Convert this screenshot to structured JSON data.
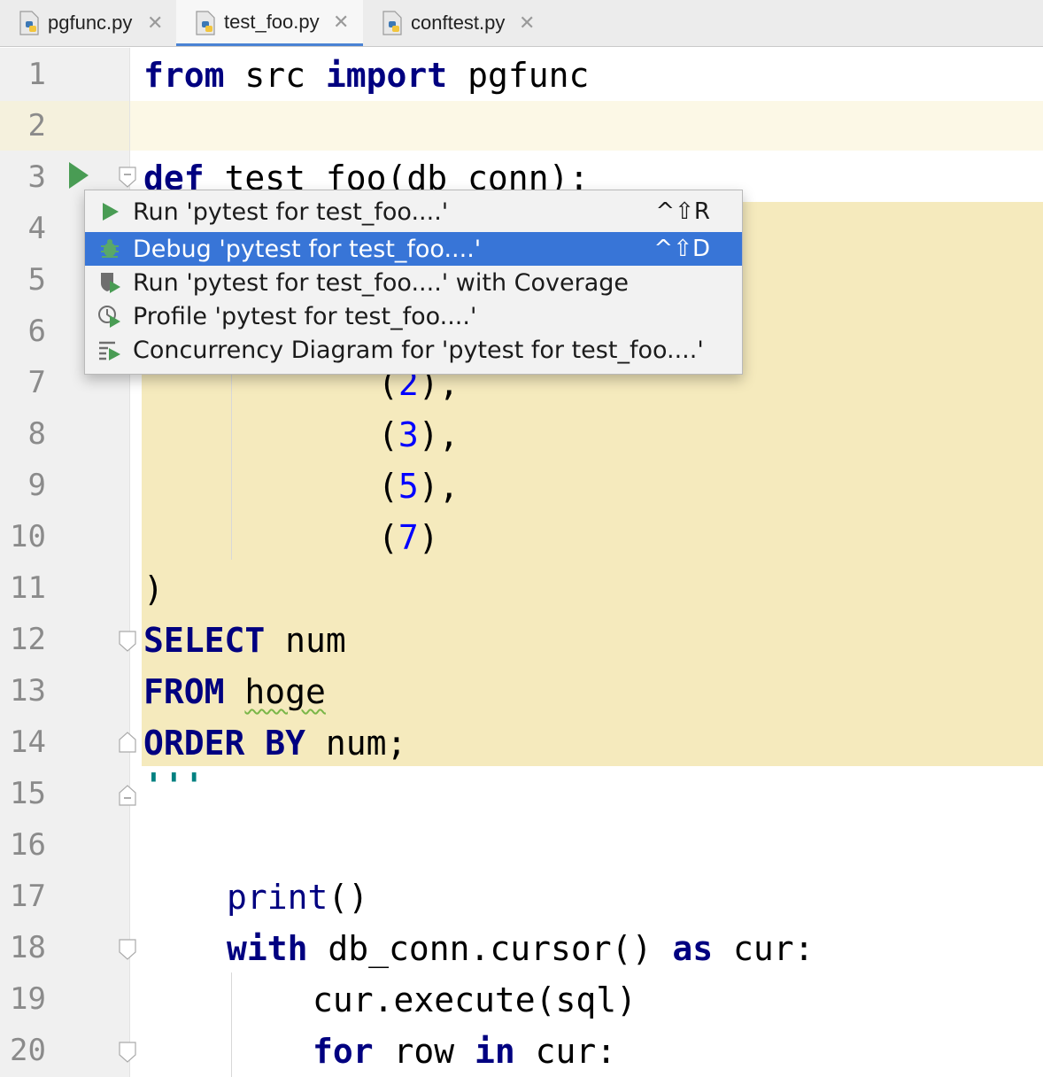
{
  "tabs": [
    {
      "label": "pgfunc.py",
      "close": "✕",
      "active": false,
      "icon": "python-file-icon"
    },
    {
      "label": "test_foo.py",
      "close": "✕",
      "active": true,
      "icon": "python-file-icon"
    },
    {
      "label": "conftest.py",
      "close": "✕",
      "active": false,
      "icon": "python-file-icon"
    }
  ],
  "line_numbers": [
    "1",
    "2",
    "3",
    "4",
    "5",
    "6",
    "7",
    "8",
    "9",
    "10",
    "11",
    "12",
    "13",
    "14",
    "15",
    "16",
    "17",
    "18",
    "19",
    "20"
  ],
  "code": {
    "l1": {
      "kw1": "from",
      "t1": " src ",
      "kw2": "import",
      "t2": " pgfunc"
    },
    "l3": {
      "kw": "def",
      "t": " test_foo(db_conn):"
    },
    "l7": {
      "open": "(",
      "n": "2",
      "close": "),"
    },
    "l8": {
      "open": "(",
      "n": "3",
      "close": "),"
    },
    "l9": {
      "open": "(",
      "n": "5",
      "close": "),"
    },
    "l10": {
      "open": "(",
      "n": "7",
      "close": ")"
    },
    "l11": ")",
    "l12": {
      "kw": "SELECT",
      "t": " num"
    },
    "l13": {
      "kw": "FROM",
      "t": " ",
      "ident": "hoge"
    },
    "l14": {
      "kw1": "ORDER",
      "t1": " ",
      "kw2": "BY",
      "t2": " num;"
    },
    "l15": "'''",
    "l17": {
      "fn": "print",
      "t": "()"
    },
    "l18": {
      "kw1": "with",
      "t1": " db_conn.cursor() ",
      "kw2": "as",
      "t2": " cur:"
    },
    "l19": "cur.execute(sql)",
    "l20": {
      "kw1": "for",
      "t1": " row ",
      "kw2": "in",
      "t2": " cur:"
    }
  },
  "popup": {
    "items": [
      {
        "label": "Run 'pytest for test_foo....'",
        "shortcut": "^⇧R",
        "icon": "run-icon"
      },
      {
        "label": "Debug 'pytest for test_foo....'",
        "shortcut": "^⇧D",
        "icon": "debug-bug-icon",
        "selected": true
      },
      {
        "label": "Run 'pytest for test_foo....' with Coverage",
        "shortcut": "",
        "icon": "coverage-shield-icon"
      },
      {
        "label": "Profile 'pytest for test_foo....'",
        "shortcut": "",
        "icon": "profile-clock-icon"
      },
      {
        "label": "Concurrency Diagram for 'pytest for test_foo....'",
        "shortcut": "",
        "icon": "concurrency-diagram-icon"
      }
    ]
  },
  "colors": {
    "keyword": "#000080",
    "number": "#0000ff",
    "selection": "#3875d7",
    "run_green": "#499c54",
    "sql_highlight": "#f5eabd"
  }
}
